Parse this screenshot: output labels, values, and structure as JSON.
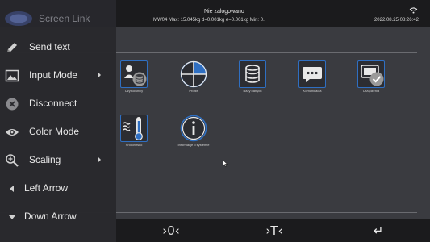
{
  "device": {
    "status_user": "Nie zalogowano",
    "status_weights": "MW04 Max: 15.045kg d=0.001kg e=0.001kg Min: 0.",
    "datetime": "2022.08.25 08:26:42"
  },
  "tiles": [
    {
      "label": "Użytkownicy",
      "icon": "users-database-icon"
    },
    {
      "label": "Profile",
      "icon": "profile-pie-icon"
    },
    {
      "label": "Bazy danych",
      "icon": "database-icon"
    },
    {
      "label": "Komunikacja",
      "icon": "chat-bubble-icon"
    },
    {
      "label": "Urządzenia",
      "icon": "devices-check-icon"
    },
    {
      "label": "Środowisko",
      "icon": "environment-thermometer-icon"
    },
    {
      "label": "Informacje o systemie",
      "icon": "info-icon"
    }
  ],
  "bottom_bar": {
    "zero_label": "›0‹",
    "tare_label": "›T‹",
    "enter_label": "↵"
  },
  "menu": {
    "title": "Screen Link",
    "items": [
      {
        "label": "Send text",
        "icon": "pencil-icon"
      },
      {
        "label": "Input Mode",
        "icon": "image-icon",
        "submenu": true
      },
      {
        "label": "Disconnect",
        "icon": "close-circle-icon"
      },
      {
        "label": "Color Mode",
        "icon": "eye-icon"
      },
      {
        "label": "Scaling",
        "icon": "zoom-icon",
        "submenu": true
      },
      {
        "label": "Left Arrow",
        "icon": "arrow-left-icon"
      },
      {
        "label": "Down Arrow",
        "icon": "arrow-down-icon"
      }
    ]
  },
  "colors": {
    "accent": "#2f6fc2",
    "menu_bg": "#28282c",
    "screen_bg": "#3a3b40"
  }
}
